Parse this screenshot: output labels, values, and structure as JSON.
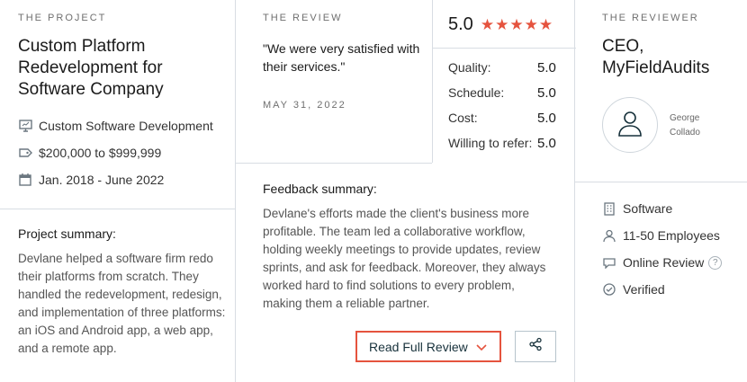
{
  "project": {
    "eyebrow": "THE PROJECT",
    "title": "Custom Platform Redevelopment for Software Company",
    "service": "Custom Software Development",
    "budget": "$200,000 to $999,999",
    "dates": "Jan. 2018 - June 2022",
    "summary_title": "Project summary:",
    "summary_text": "Devlane helped a software firm redo their platforms from scratch. They handled the redevelopment, redesign, and implementation of three platforms: an iOS and Android app, a web app, and a remote app."
  },
  "review": {
    "eyebrow": "THE REVIEW",
    "quote": "\"We were very satisfied with their services.\"",
    "date": "MAY 31, 2022",
    "overall": "5.0",
    "stars": 5,
    "ratings": [
      {
        "label": "Quality:",
        "value": "5.0"
      },
      {
        "label": "Schedule:",
        "value": "5.0"
      },
      {
        "label": "Cost:",
        "value": "5.0"
      },
      {
        "label": "Willing to refer:",
        "value": "5.0"
      }
    ],
    "feedback_title": "Feedback summary:",
    "feedback_text": "Devlane's efforts made the client's business more profitable. The team led a collaborative workflow, holding weekly meetings to provide updates, review sprints, and ask for feedback. Moreover, they always worked hard to find solutions to every problem, making them a reliable partner.",
    "read_button": "Read Full Review"
  },
  "reviewer": {
    "eyebrow": "THE REVIEWER",
    "title": "CEO, MyFieldAudits",
    "name": "George Collado",
    "industry": "Software",
    "size": "11-50 Employees",
    "review_type": "Online Review",
    "help": "?",
    "status": "Verified"
  },
  "colors": {
    "accent": "#e5533e",
    "border": "#d8dde3",
    "text_muted": "#555555"
  }
}
